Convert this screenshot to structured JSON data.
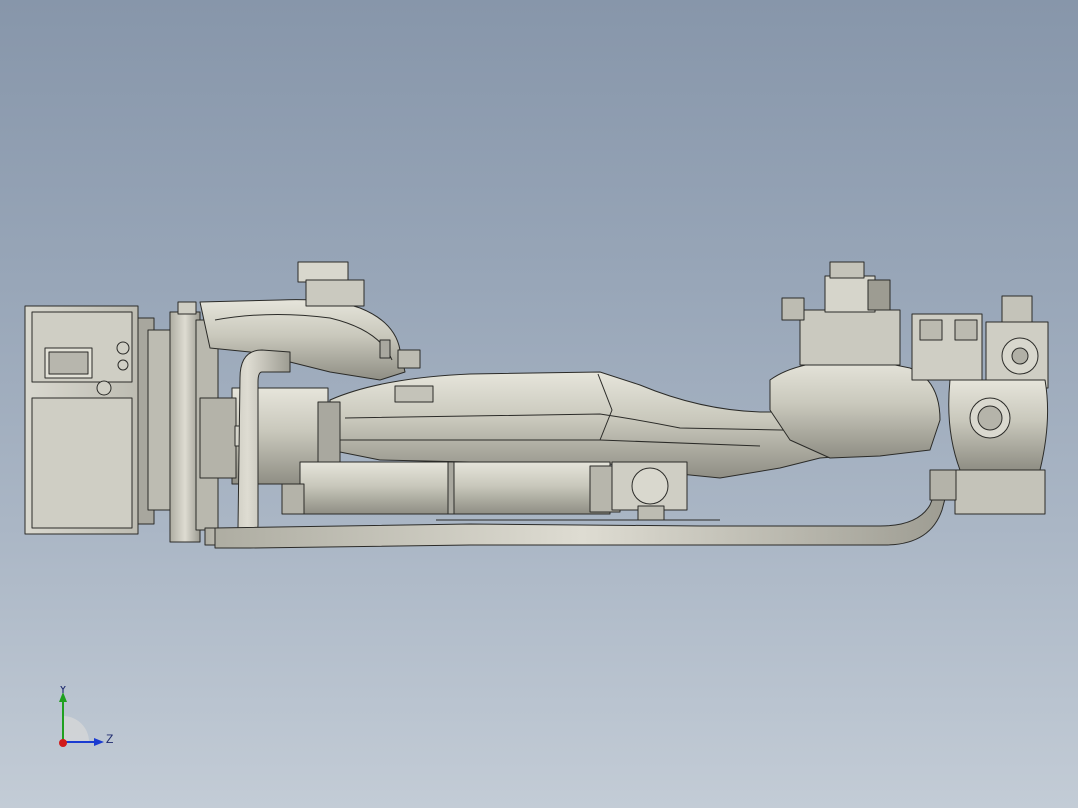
{
  "viewport": {
    "background_top": "#8796aa",
    "background_bottom": "#c3ccd6"
  },
  "model": {
    "metal_color": "#c9c8bc",
    "metal_dark": "#8f8e84",
    "edge_color": "#2b2b28"
  },
  "triad": {
    "y_label": "Y",
    "z_label": "Z",
    "y_color": "#1fa01f",
    "z_color": "#1a3bd1",
    "x_color": "#d11a1a"
  }
}
